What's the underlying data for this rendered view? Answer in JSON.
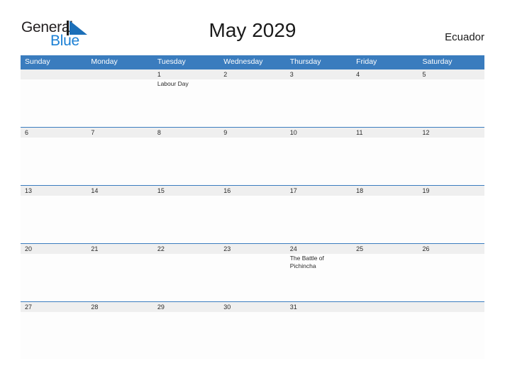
{
  "brand": {
    "name_part1": "General",
    "name_part2": "Blue",
    "flag_icon": "triangle-flag-icon",
    "accent_color": "#1a7fd4"
  },
  "header": {
    "title": "May 2029",
    "country": "Ecuador"
  },
  "theme": {
    "header_blue": "#3a7cbe",
    "date_strip_gray": "#efefef",
    "body_white": "#fdfdfd",
    "text_dark": "#1a1a1a"
  },
  "calendar": {
    "month": "May",
    "year": "2029",
    "weekdays": [
      "Sunday",
      "Monday",
      "Tuesday",
      "Wednesday",
      "Thursday",
      "Friday",
      "Saturday"
    ],
    "weeks": [
      {
        "days": [
          {
            "date": "",
            "event": ""
          },
          {
            "date": "",
            "event": ""
          },
          {
            "date": "1",
            "event": "Labour Day"
          },
          {
            "date": "2",
            "event": ""
          },
          {
            "date": "3",
            "event": ""
          },
          {
            "date": "4",
            "event": ""
          },
          {
            "date": "5",
            "event": ""
          }
        ]
      },
      {
        "days": [
          {
            "date": "6",
            "event": ""
          },
          {
            "date": "7",
            "event": ""
          },
          {
            "date": "8",
            "event": ""
          },
          {
            "date": "9",
            "event": ""
          },
          {
            "date": "10",
            "event": ""
          },
          {
            "date": "11",
            "event": ""
          },
          {
            "date": "12",
            "event": ""
          }
        ]
      },
      {
        "days": [
          {
            "date": "13",
            "event": ""
          },
          {
            "date": "14",
            "event": ""
          },
          {
            "date": "15",
            "event": ""
          },
          {
            "date": "16",
            "event": ""
          },
          {
            "date": "17",
            "event": ""
          },
          {
            "date": "18",
            "event": ""
          },
          {
            "date": "19",
            "event": ""
          }
        ]
      },
      {
        "days": [
          {
            "date": "20",
            "event": ""
          },
          {
            "date": "21",
            "event": ""
          },
          {
            "date": "22",
            "event": ""
          },
          {
            "date": "23",
            "event": ""
          },
          {
            "date": "24",
            "event": "The Battle of Pichincha"
          },
          {
            "date": "25",
            "event": ""
          },
          {
            "date": "26",
            "event": ""
          }
        ]
      },
      {
        "days": [
          {
            "date": "27",
            "event": ""
          },
          {
            "date": "28",
            "event": ""
          },
          {
            "date": "29",
            "event": ""
          },
          {
            "date": "30",
            "event": ""
          },
          {
            "date": "31",
            "event": ""
          },
          {
            "date": "",
            "event": ""
          },
          {
            "date": "",
            "event": ""
          }
        ]
      }
    ]
  }
}
